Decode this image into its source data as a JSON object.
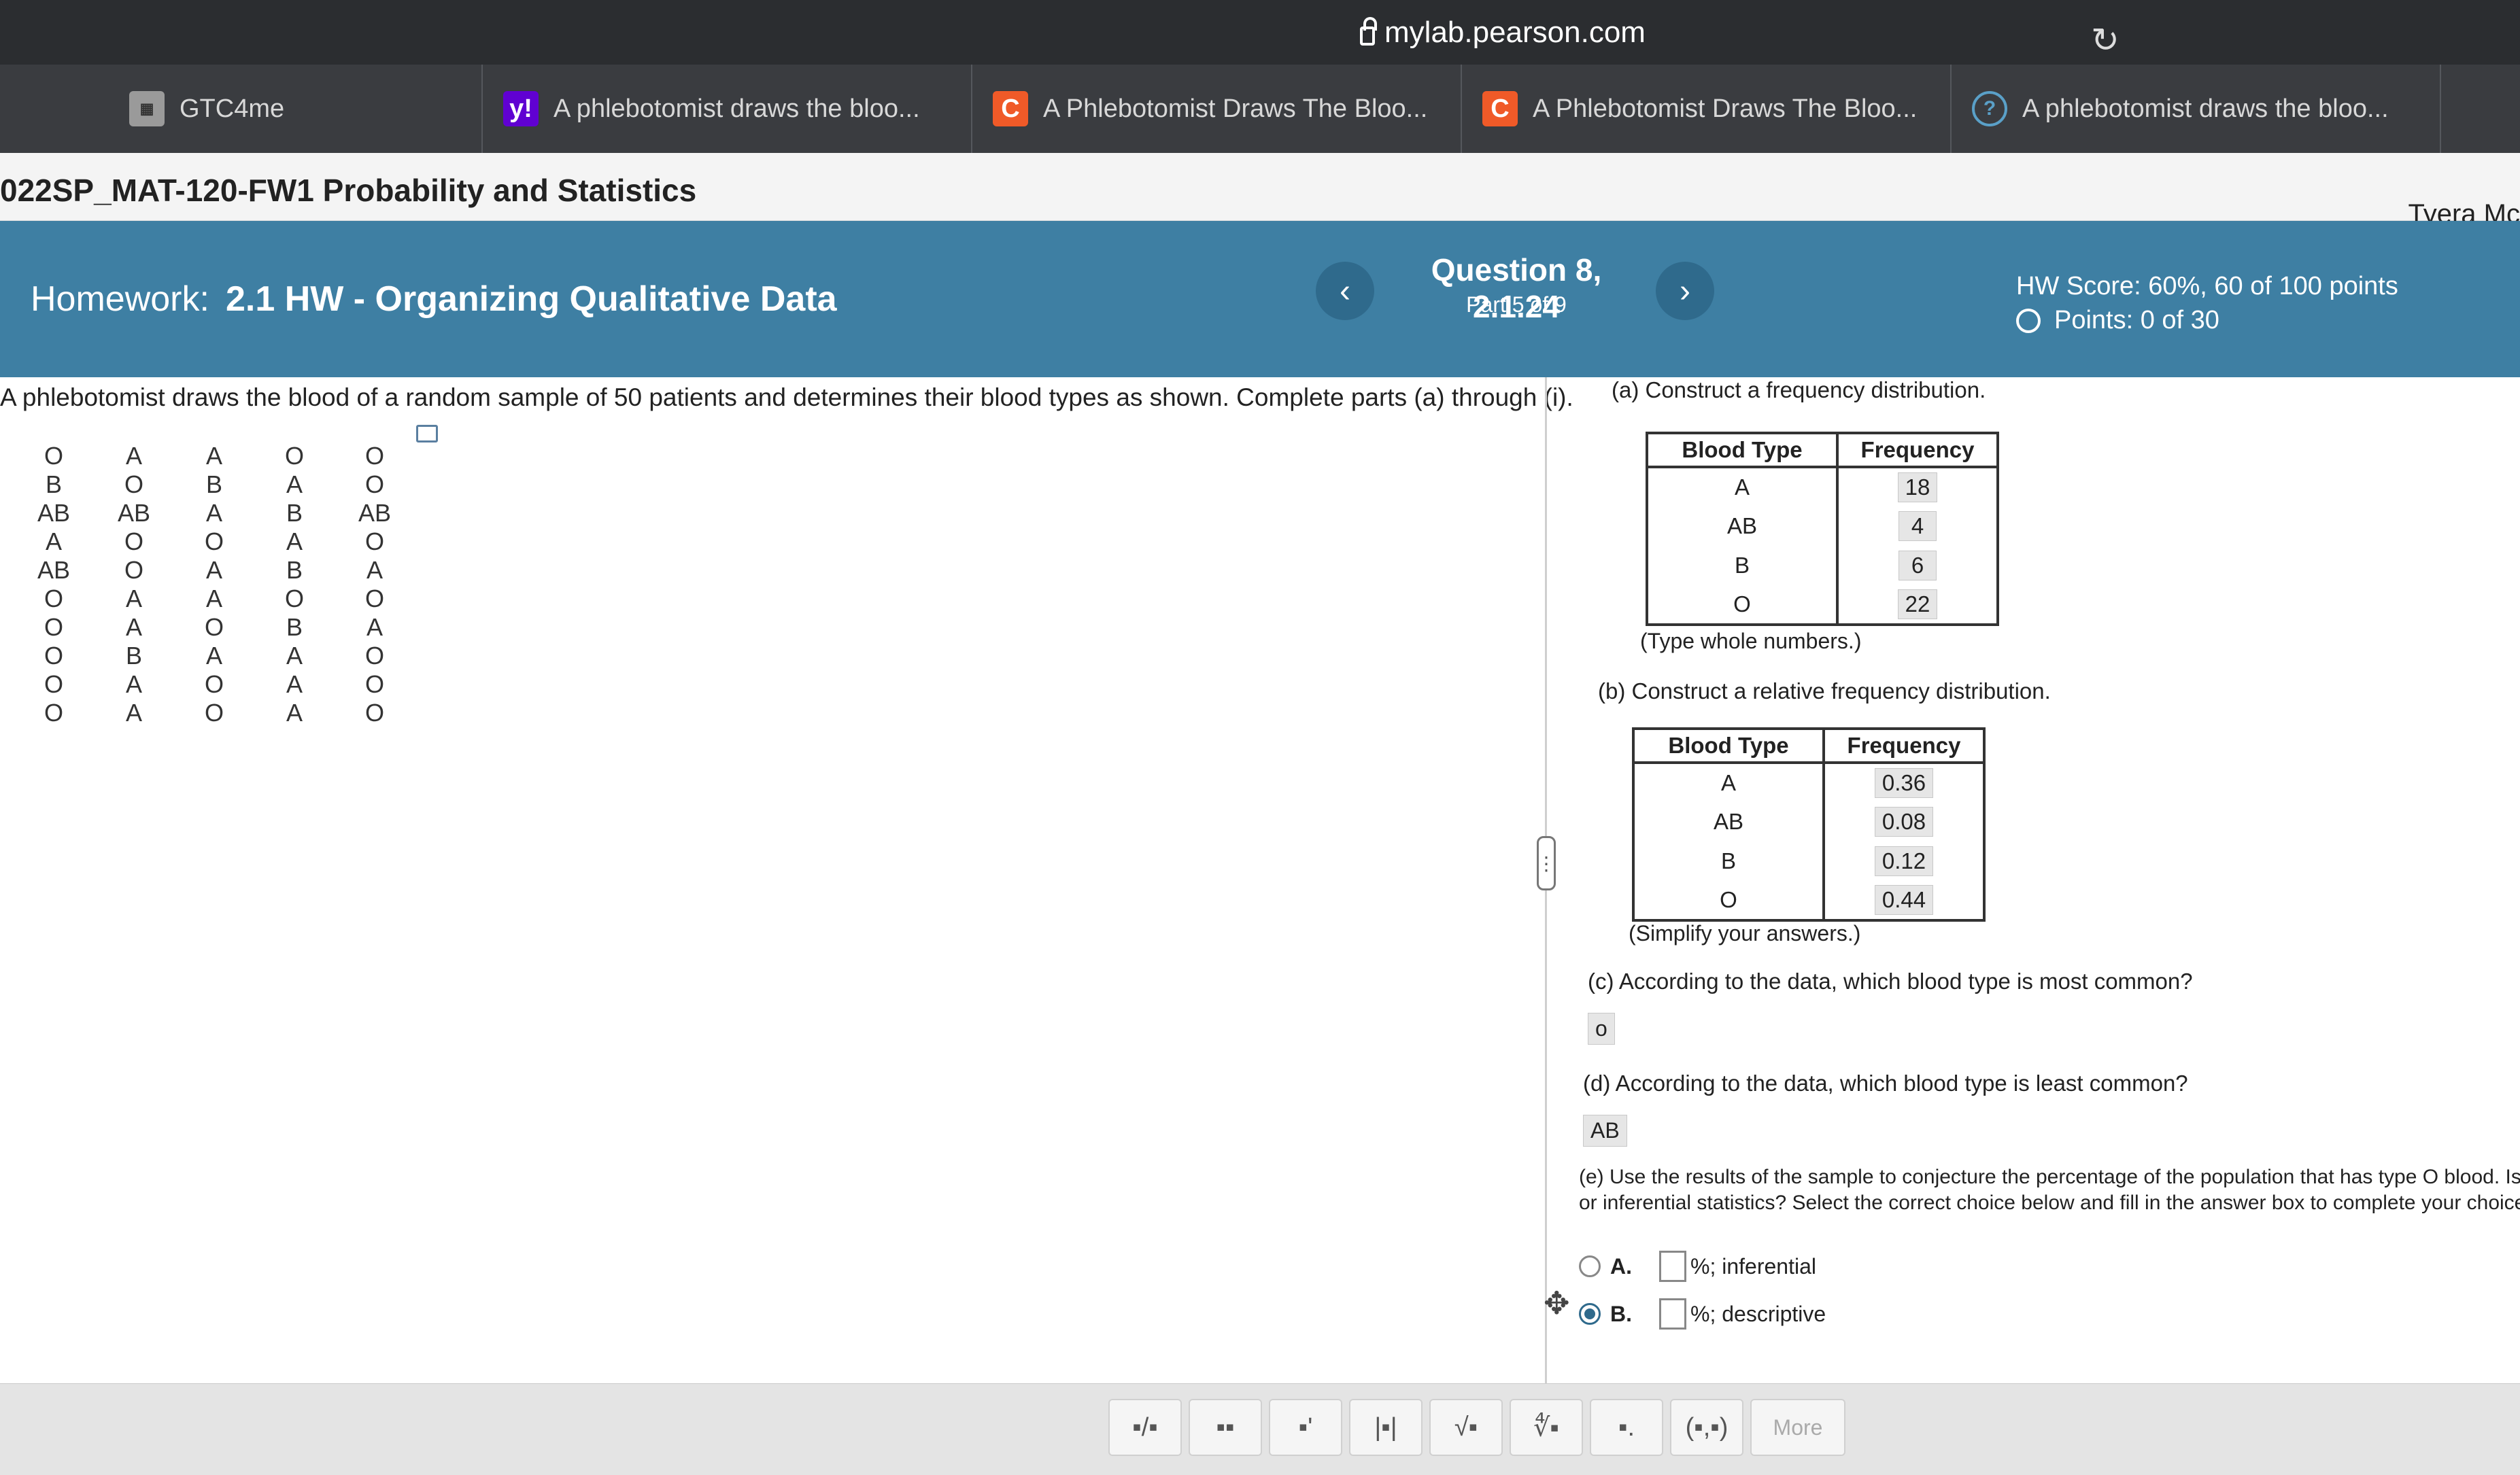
{
  "browser": {
    "url": "mylab.pearson.com",
    "tabs": [
      {
        "label": "GTC4me",
        "icon": "gtc-icon"
      },
      {
        "label": "A phlebotomist draws the bloo...",
        "icon": "yahoo-icon"
      },
      {
        "label": "A Phlebotomist Draws The Bloo...",
        "icon": "chegg-icon"
      },
      {
        "label": "A Phlebotomist Draws The Bloo...",
        "icon": "chegg-icon"
      },
      {
        "label": "A phlebotomist draws the bloo...",
        "icon": "question-icon"
      }
    ]
  },
  "course": {
    "title": "022SP_MAT-120-FW1 Probability and Statistics",
    "user": "Tyera Mc"
  },
  "header": {
    "homework_label": "Homework:",
    "homework_title": "2.1 HW - Organizing Qualitative Data",
    "question_title": "Question 8, 2.1.24",
    "question_part": "Part 5 of 9",
    "hw_score": "HW Score: 60%, 60 of 100 points",
    "points": "Points: 0 of 30",
    "prev_label": "‹",
    "next_label": "›"
  },
  "problem": {
    "intro": "A phlebotomist draws the blood of a random sample of 50 patients and determines their blood types as shown. Complete parts (a) through (i).",
    "rows": [
      [
        "O",
        "A",
        "A",
        "O",
        "O"
      ],
      [
        "B",
        "O",
        "B",
        "A",
        "O"
      ],
      [
        "AB",
        "AB",
        "A",
        "B",
        "AB"
      ],
      [
        "A",
        "O",
        "O",
        "A",
        "O"
      ],
      [
        "AB",
        "O",
        "A",
        "B",
        "A"
      ],
      [
        "O",
        "A",
        "A",
        "O",
        "O"
      ],
      [
        "O",
        "A",
        "O",
        "B",
        "A"
      ],
      [
        "O",
        "B",
        "A",
        "A",
        "O"
      ],
      [
        "O",
        "A",
        "O",
        "A",
        "O"
      ],
      [
        "O",
        "A",
        "O",
        "A",
        "O"
      ]
    ]
  },
  "part_a": {
    "prompt": "(a) Construct a frequency distribution.",
    "col1": "Blood Type",
    "col2": "Frequency",
    "rows": [
      {
        "type": "A",
        "freq": "18"
      },
      {
        "type": "AB",
        "freq": "4"
      },
      {
        "type": "B",
        "freq": "6"
      },
      {
        "type": "O",
        "freq": "22"
      }
    ],
    "note": "(Type whole numbers.)"
  },
  "part_b": {
    "prompt": "(b) Construct a relative frequency distribution.",
    "col1": "Blood Type",
    "col2": "Frequency",
    "rows": [
      {
        "type": "A",
        "freq": "0.36"
      },
      {
        "type": "AB",
        "freq": "0.08"
      },
      {
        "type": "B",
        "freq": "0.12"
      },
      {
        "type": "O",
        "freq": "0.44"
      }
    ],
    "note": "(Simplify your answers.)"
  },
  "part_c": {
    "prompt": "(c) According to the data, which blood type is most common?",
    "answer": "o"
  },
  "part_d": {
    "prompt": "(d) According to the data, which blood type is least common?",
    "answer": "AB"
  },
  "part_e": {
    "prompt_line1": "(e) Use the results of the sample to conjecture the percentage of the population that has type O blood. Is",
    "prompt_line2": "or inferential statistics? Select the correct choice below and fill in the answer box to complete your choice",
    "choice_a_letter": "A.",
    "choice_a_text": "%; inferential",
    "choice_b_letter": "B.",
    "choice_b_text": "%; descriptive",
    "selected": "B"
  },
  "toolbar": {
    "buttons": [
      "▪/▪",
      "▪▪",
      "▪'",
      "|▪|",
      "√▪",
      "∜▪",
      "▪.",
      "(▪,▪)"
    ],
    "more": "More"
  }
}
